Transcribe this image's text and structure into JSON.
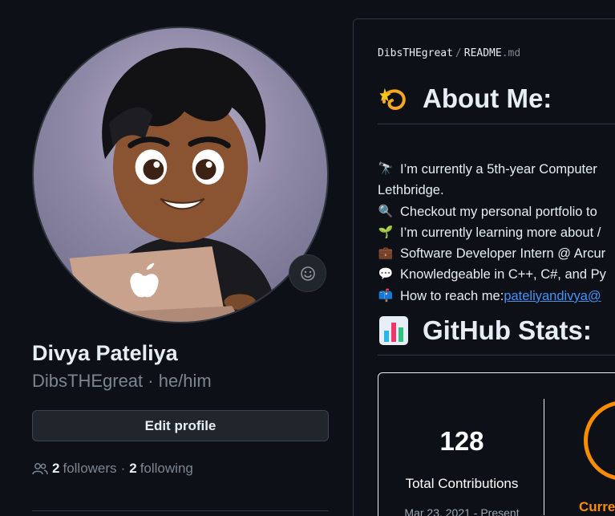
{
  "profile": {
    "name": "Divya Pateliya",
    "username_line": "DibsTHEgreat · he/him",
    "edit_button": "Edit profile",
    "followers_count": "2",
    "followers_label": "followers",
    "dot": "·",
    "following_count": "2",
    "following_label": "following",
    "avatar_logo": "apple-logo-icon",
    "emoji_icon": "smiley-icon"
  },
  "readme": {
    "repo": "DibsTHEgreat",
    "separator": "/",
    "file": "README",
    "ext": ".md",
    "about_heading": "About Me:",
    "about_icon": "dizzy-icon",
    "lines": [
      {
        "emoji": "🔭",
        "text": "I’m currently a 5th-year Computer"
      },
      {
        "emoji": "",
        "text": "Lethbridge."
      },
      {
        "emoji": "🔍",
        "text": "Checkout my personal portfolio to"
      },
      {
        "emoji": "🌱",
        "text": "I’m currently learning more about /"
      },
      {
        "emoji": "💼",
        "text": "Software Developer Intern @ Arcur"
      },
      {
        "emoji": "💬",
        "text": "Knowledgeable in C++, C#, and Py"
      },
      {
        "emoji": "📫",
        "text": "How to reach me: ",
        "link": "pateliyandivya@"
      }
    ],
    "stats_heading": "GitHub Stats:",
    "stats_icon": "bar-chart-icon"
  },
  "stats_card": {
    "total": "128",
    "total_label": "Total Contributions",
    "range": "Mar 23, 2021 - Present",
    "streak_label": "Curre",
    "accent": "#fb8c00"
  }
}
